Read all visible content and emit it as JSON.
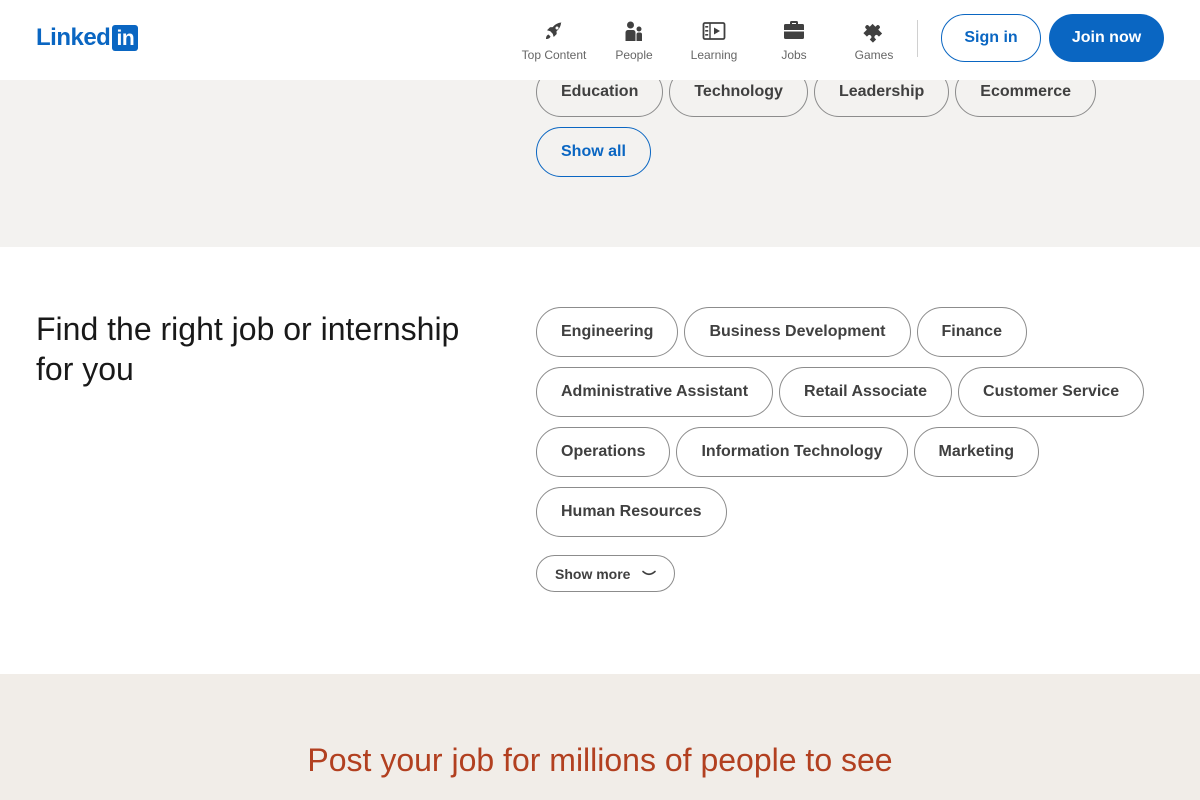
{
  "header": {
    "logo_text": "Linked",
    "logo_box_text": "in",
    "nav": [
      {
        "label": "Top Content",
        "icon": "rocket-icon"
      },
      {
        "label": "People",
        "icon": "people-icon"
      },
      {
        "label": "Learning",
        "icon": "learning-icon"
      },
      {
        "label": "Jobs",
        "icon": "briefcase-icon"
      },
      {
        "label": "Games",
        "icon": "puzzle-icon"
      }
    ],
    "signin_label": "Sign in",
    "join_label": "Join now"
  },
  "topics": {
    "pills": [
      "Education",
      "Technology",
      "Leadership",
      "Ecommerce"
    ],
    "show_all_label": "Show all"
  },
  "jobs": {
    "heading": "Find the right job or internship for you",
    "pills": [
      "Engineering",
      "Business Development",
      "Finance",
      "Administrative Assistant",
      "Retail Associate",
      "Customer Service",
      "Operations",
      "Information Technology",
      "Marketing",
      "Human Resources"
    ],
    "show_more_label": "Show more"
  },
  "post": {
    "heading": "Post your job for millions of people to see"
  },
  "colors": {
    "brand_blue": "#0a66c2",
    "post_heading": "#b24020",
    "section_gray": "#f3f2f0",
    "section_beige": "#f1ede8"
  }
}
